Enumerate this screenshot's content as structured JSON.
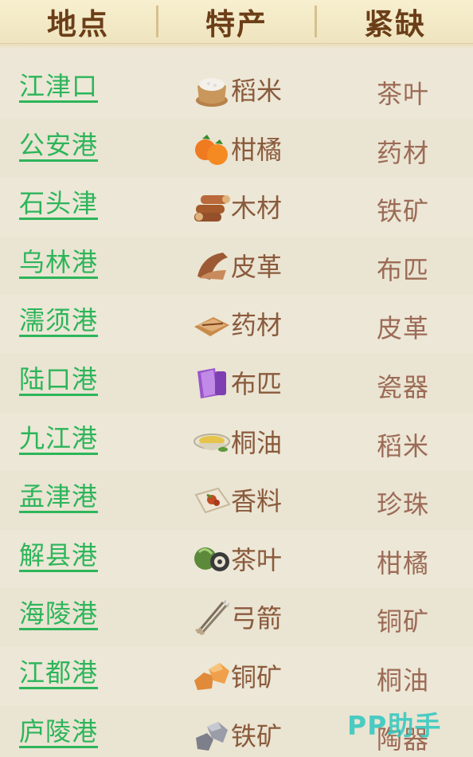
{
  "headers": {
    "location": "地点",
    "specialty": "特产",
    "shortage": "紧缺"
  },
  "rows": [
    {
      "location": "江津口",
      "specialty": "稻米",
      "specialty_icon": "rice-sack-icon",
      "shortage": "茶叶"
    },
    {
      "location": "公安港",
      "specialty": "柑橘",
      "specialty_icon": "orange-icon",
      "shortage": "药材"
    },
    {
      "location": "石头津",
      "specialty": "木材",
      "specialty_icon": "logs-icon",
      "shortage": "铁矿"
    },
    {
      "location": "乌林港",
      "specialty": "皮革",
      "specialty_icon": "leather-icon",
      "shortage": "布匹"
    },
    {
      "location": "濡须港",
      "specialty": "药材",
      "specialty_icon": "herbs-icon",
      "shortage": "皮革"
    },
    {
      "location": "陆口港",
      "specialty": "布匹",
      "specialty_icon": "cloth-icon",
      "shortage": "瓷器"
    },
    {
      "location": "九江港",
      "specialty": "桐油",
      "specialty_icon": "oil-bowl-icon",
      "shortage": "稻米"
    },
    {
      "location": "孟津港",
      "specialty": "香料",
      "specialty_icon": "spice-icon",
      "shortage": "珍珠"
    },
    {
      "location": "解县港",
      "specialty": "茶叶",
      "specialty_icon": "tea-icon",
      "shortage": "柑橘"
    },
    {
      "location": "海陵港",
      "specialty": "弓箭",
      "specialty_icon": "arrows-icon",
      "shortage": "铜矿"
    },
    {
      "location": "江都港",
      "specialty": "铜矿",
      "specialty_icon": "copper-ore-icon",
      "shortage": "桐油"
    },
    {
      "location": "庐陵港",
      "specialty": "铁矿",
      "specialty_icon": "iron-ore-icon",
      "shortage": "陶器"
    }
  ],
  "watermark": "PP助手",
  "colors": {
    "header_text": "#6b3e18",
    "link": "#2db55a",
    "item_text": "#8a5a3c",
    "shortage_text": "#9c6b57"
  }
}
